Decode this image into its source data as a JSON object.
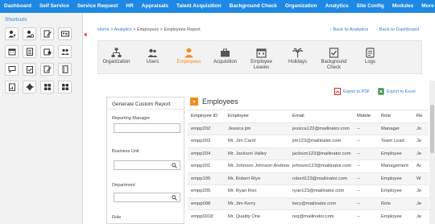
{
  "nav": {
    "items": [
      "Dashboard",
      "Self Service",
      "Service Request",
      "HR",
      "Appraisals",
      "Talent Acquisition",
      "Background Check",
      "Organization",
      "Analytics",
      "Site Config",
      "Modules",
      "More"
    ]
  },
  "sidebar": {
    "title": "Shortcuts",
    "shortcuts": [
      "user-star-icon",
      "user-gear-icon",
      "edit-doc-icon",
      "id-card-icon",
      "calendar-icon",
      "checklist-icon",
      "wallet-icon",
      "group-icon",
      "chat-icon",
      "clipboard-check-icon",
      "edit-doc-icon",
      "list-icon",
      "report-icon",
      "gear-icon",
      "apps-grid-icon",
      "apps-grid-icon"
    ]
  },
  "breadcrumb": {
    "home": "Home",
    "sep": " > ",
    "analytics": "Analytics",
    "employees": "Employees",
    "current": "Employees Report"
  },
  "links": {
    "back_analytics": "Back to Analytics",
    "back_dashboard": "Back to Dashboard"
  },
  "tabs": [
    {
      "label": "Organization",
      "icon": "organization-icon"
    },
    {
      "label": "Users",
      "icon": "users-icon"
    },
    {
      "label": "Employees",
      "icon": "employees-icon",
      "active": true
    },
    {
      "label": "Acquisition",
      "icon": "briefcase-icon"
    },
    {
      "label": "Employee Leaves",
      "icon": "calendar-icon"
    },
    {
      "label": "Holidays",
      "icon": "holiday-icon"
    },
    {
      "label": "Background Check",
      "icon": "background-check-icon"
    },
    {
      "label": "Logs",
      "icon": "logs-icon"
    }
  ],
  "export": {
    "pdf": "Export to PDF",
    "excel": "Export to Excel"
  },
  "report": {
    "title": "Generate Custom Report",
    "fields": [
      "Reporting Manager",
      "Business Unit",
      "Department",
      "Role"
    ]
  },
  "employees": {
    "title": "Employees",
    "columns": [
      "Employee ID",
      "Employee",
      "Email",
      "Mobile",
      "Role",
      "Re"
    ],
    "rows": [
      [
        "empp202",
        "Jessica jim",
        "jessica123@mailinator.com",
        "--",
        "Manager",
        "Jo"
      ],
      [
        "empp203",
        "Mr. Jim Carol",
        "jim123@mailinator.com",
        "--",
        "Team Lead",
        "Je"
      ],
      [
        "empp204",
        "Mr. Jackson Valley",
        "jackson123@mailinator.com",
        "--",
        "Employee",
        "Je"
      ],
      [
        "empp201",
        "Mr. Johnson Johnson Andrew",
        "johnson123@mailinator.com",
        "--",
        "Management",
        "Ar"
      ],
      [
        "empp105",
        "Mr. Robert Riyo",
        "robert123@mailinator.com",
        "--",
        "Employee",
        "W"
      ],
      [
        "empp205",
        "Mr. Ryan Ron",
        "ryan123@mailinator.com",
        "--",
        "Employee",
        "Je"
      ],
      [
        "empp008",
        "Mr. Jim Kerry",
        "kery@mailinator.com",
        "--",
        "Role",
        "Je"
      ],
      [
        "empp0018",
        "Mr. Quality One",
        "req@mailinator.com",
        "--",
        "Employee",
        "Je"
      ]
    ]
  },
  "colors": {
    "nav_bg": "#1e88e5",
    "accent": "#f28b1d",
    "link": "#2f7fd1"
  }
}
